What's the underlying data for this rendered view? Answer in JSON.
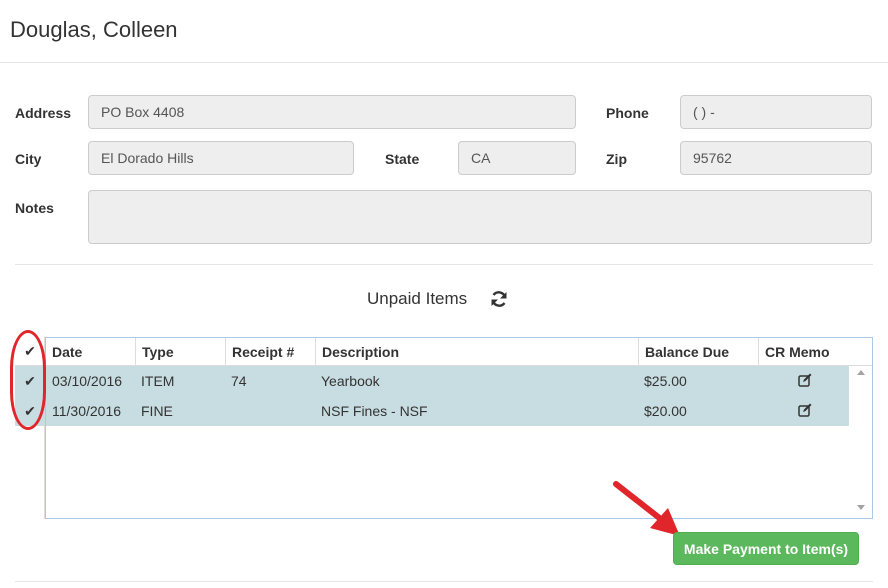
{
  "page": {
    "title": "Douglas, Colleen"
  },
  "form": {
    "address_label": "Address",
    "address_value": "PO Box 4408",
    "phone_label": "Phone",
    "phone_value": "( ) -",
    "city_label": "City",
    "city_value": "El Dorado Hills",
    "state_label": "State",
    "state_value": "CA",
    "zip_label": "Zip",
    "zip_value": "95762",
    "notes_label": "Notes",
    "notes_value": ""
  },
  "unpaid": {
    "title": "Unpaid Items",
    "refresh_icon": "refresh-icon",
    "select_all_glyph": "✔",
    "columns": [
      "Date",
      "Type",
      "Receipt #",
      "Description",
      "Balance Due",
      "CR Memo"
    ],
    "rows": [
      {
        "check": "✔",
        "date": "03/10/2016",
        "type": "ITEM",
        "receipt": "74",
        "description": "Yearbook",
        "balance": "$25.00"
      },
      {
        "check": "✔",
        "date": "11/30/2016",
        "type": "FINE",
        "receipt": "",
        "description": "NSF Fines - NSF",
        "balance": "$20.00"
      }
    ],
    "selection_color": "#c8dde2"
  },
  "actions": {
    "pay_label": "Make Payment to Item(s)",
    "pay_color": "#5cb85c"
  },
  "annotations": {
    "highlight_color": "#e0262a"
  }
}
